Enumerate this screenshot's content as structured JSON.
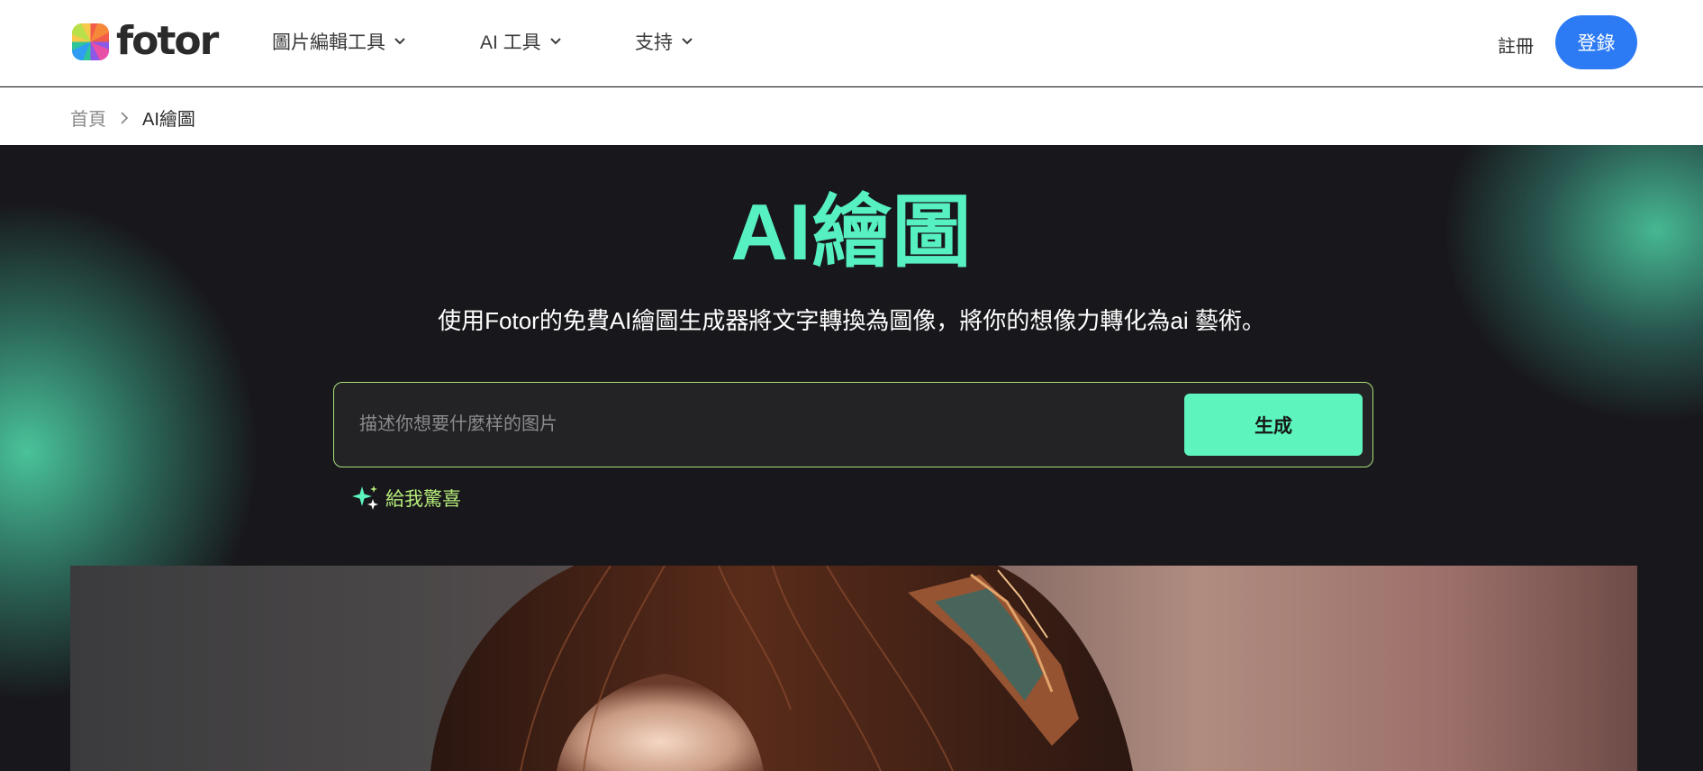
{
  "header": {
    "logo_text": "fotor",
    "nav": [
      {
        "label": "圖片編輯工具"
      },
      {
        "label": "AI 工具"
      },
      {
        "label": "支持"
      }
    ],
    "signup_label": "註冊",
    "login_label": "登錄"
  },
  "breadcrumb": {
    "home": "首頁",
    "current": "AI繪圖"
  },
  "hero": {
    "title": "AI繪圖",
    "subtitle": "使用Fotor的免費AI繪圖生成器將文字轉換為圖像，將你的想像力轉化為ai 藝術。",
    "prompt_value": "",
    "prompt_placeholder": "描述你想要什麼样的图片",
    "generate_label": "生成",
    "surprise_label": "給我驚喜"
  },
  "colors": {
    "accent_green": "#56f0c2",
    "button_green": "#5df5bd",
    "login_blue": "#2d7bf4",
    "surprise_text": "#b6ec7a",
    "background": "#18171b"
  },
  "icons": {
    "logo": "fotor-rainbow-logo-icon",
    "nav_dropdown": "chevron-down-icon",
    "breadcrumb_separator": "chevron-right-icon",
    "surprise": "sparkle-icon"
  }
}
